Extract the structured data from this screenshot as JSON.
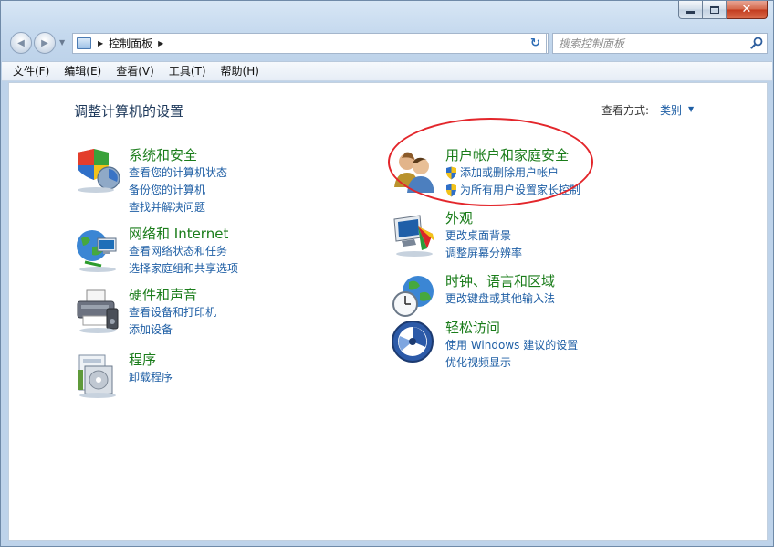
{
  "window": {
    "buttons": {
      "minimize": "minimize",
      "maximize": "maximize",
      "close": "✕"
    }
  },
  "nav": {
    "back_glyph": "◀",
    "forward_glyph": "▶",
    "dropdown_glyph": "▼",
    "breadcrumb_separator": "▶",
    "breadcrumb": "控制面板",
    "refresh_glyph": "↻",
    "search_placeholder": "搜索控制面板"
  },
  "menubar": {
    "items": [
      "文件(F)",
      "编辑(E)",
      "查看(V)",
      "工具(T)",
      "帮助(H)"
    ]
  },
  "content": {
    "title": "调整计算机的设置",
    "view_by_label": "查看方式:",
    "view_by_value": "类别",
    "view_by_arrow": "▼",
    "left_categories": [
      {
        "title": "系统和安全",
        "icon": "shield-security-icon",
        "links": [
          "查看您的计算机状态",
          "备份您的计算机",
          "查找并解决问题"
        ]
      },
      {
        "title": "网络和 Internet",
        "icon": "network-globe-icon",
        "links": [
          "查看网络状态和任务",
          "选择家庭组和共享选项"
        ]
      },
      {
        "title": "硬件和声音",
        "icon": "printer-icon",
        "links": [
          "查看设备和打印机",
          "添加设备"
        ]
      },
      {
        "title": "程序",
        "icon": "programs-icon",
        "links": [
          "卸载程序"
        ]
      }
    ],
    "right_categories": [
      {
        "title": "用户帐户和家庭安全",
        "icon": "users-icon",
        "links": [
          "添加或删除用户帐户",
          "为所有用户设置家长控制"
        ]
      },
      {
        "title": "外观",
        "icon": "appearance-monitor-icon",
        "links": [
          "更改桌面背景",
          "调整屏幕分辨率"
        ]
      },
      {
        "title": "时钟、语言和区域",
        "icon": "clock-globe-icon",
        "links": [
          "更改键盘或其他输入法"
        ]
      },
      {
        "title": "轻松访问",
        "icon": "ease-of-access-icon",
        "links": [
          "使用 Windows 建议的设置",
          "优化视频显示"
        ]
      }
    ]
  },
  "colors": {
    "category_title": "#1a7c1a",
    "link": "#1f5fa5",
    "page_title": "#1e395b",
    "highlight": "#e3262b"
  }
}
